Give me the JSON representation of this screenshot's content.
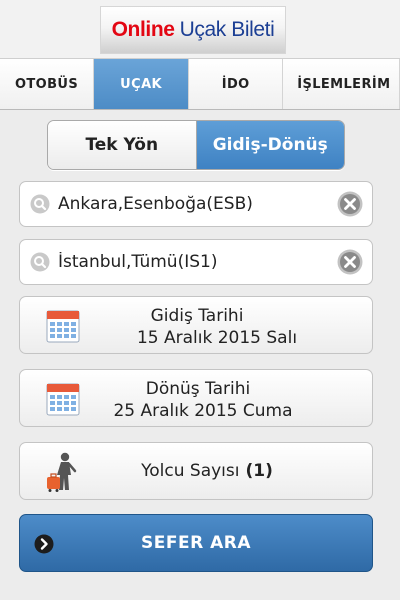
{
  "header": {
    "logo_part1": "Online",
    "logo_part2": "Uçak Bileti"
  },
  "tabs": [
    {
      "label": "OTOBÜS"
    },
    {
      "label": "UÇAK"
    },
    {
      "label": "İDO"
    },
    {
      "label": "İŞLEMLERİM"
    }
  ],
  "trip_type": {
    "one_way": "Tek Yön",
    "round_trip": "Gidiş-Dönüş",
    "selected": "Gidiş-Dönüş"
  },
  "origin": {
    "value": "Ankara,Esenboğa(ESB)"
  },
  "destination": {
    "value": "İstanbul,Tümü(IS1)"
  },
  "departure": {
    "label": "Gidiş Tarihi",
    "date": "15 Aralık 2015 Salı"
  },
  "return": {
    "label": "Dönüş Tarihi",
    "date": "25 Aralık 2015 Cuma"
  },
  "passengers": {
    "label": "Yolcu Sayısı",
    "count": "(1)"
  },
  "search": {
    "label": "SEFER ARA"
  },
  "icons": {
    "search": "search-icon",
    "clear": "clear-icon",
    "calendar": "calendar-icon",
    "traveler": "traveler-icon",
    "go": "arrow-right-circle-icon"
  },
  "colors": {
    "accent": "#4d8cc6",
    "logo_red": "#e30613",
    "logo_blue": "#1c3f94",
    "search_button": "#2f6aa6"
  }
}
